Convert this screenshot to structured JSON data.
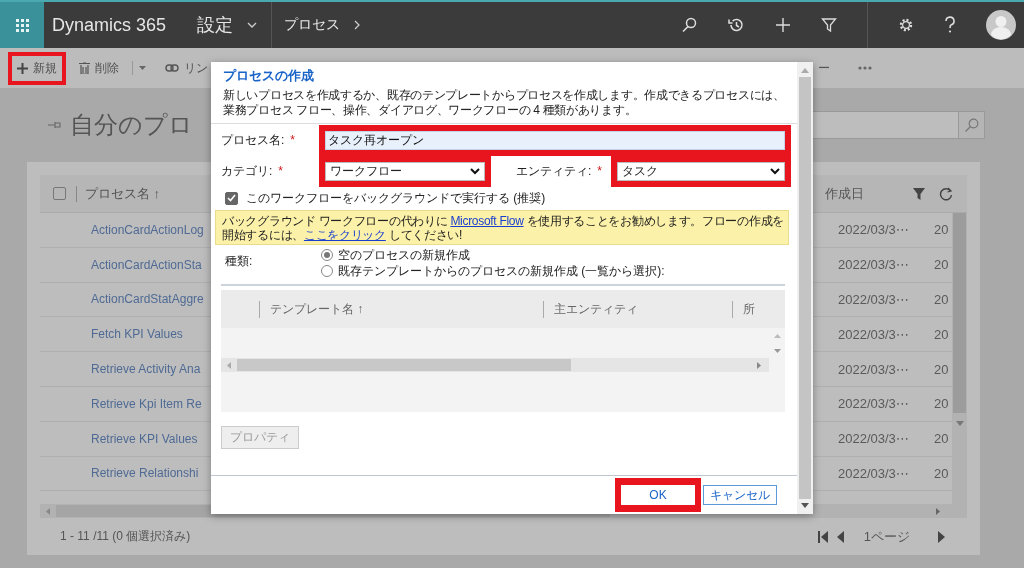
{
  "top_bar": {
    "app_title": "Dynamics 365",
    "area": "設定",
    "breadcrumb": "プロセス"
  },
  "command_bar": [
    {
      "kind": "new",
      "label": "新規",
      "highlighted": true
    },
    {
      "kind": "delete",
      "label": "削除",
      "highlighted": false
    },
    {
      "kind": "link",
      "label": "リン",
      "highlighted": false
    }
  ],
  "command_bar_right": {
    "label": "ー"
  },
  "page_title": "自分のプロ",
  "grid": {
    "select_all_checked": false,
    "columns": [
      {
        "label": "プロセス名 ↑"
      },
      {
        "label": "作成日"
      }
    ],
    "rows": [
      {
        "name": "ActionCardActionLog",
        "created": "2022/03/3⋯",
        "column_3": "20"
      },
      {
        "name": "ActionCardActionSta",
        "created": "2022/03/3⋯",
        "column_3": "20"
      },
      {
        "name": "ActionCardStatAggre",
        "created": "2022/03/3⋯",
        "column_3": "20"
      },
      {
        "name": "Fetch KPI Values",
        "created": "2022/03/3⋯",
        "column_3": "20"
      },
      {
        "name": "Retrieve Activity Ana",
        "created": "2022/03/3⋯",
        "column_3": "20"
      },
      {
        "name": "Retrieve Kpi Item Re",
        "created": "2022/03/3⋯",
        "column_3": "20"
      },
      {
        "name": "Retrieve KPI Values",
        "created": "2022/03/3⋯",
        "column_3": "20"
      },
      {
        "name": "Retrieve Relationshi",
        "created": "2022/03/3⋯",
        "column_3": "20"
      }
    ],
    "footer": "1 - 11 /11 (0 個選択済み)",
    "page": "1ページ"
  },
  "dialog": {
    "title": "プロセスの作成",
    "description": "新しいプロセスを作成するか、既存のテンプレートからプロセスを作成します。作成できるプロセスには、業務プロセス フロー、操作、ダイアログ、ワークフローの 4 種類があります。",
    "process_name": {
      "label": "プロセス名:",
      "required_mark": "*",
      "value": "タスク再オープン",
      "highlighted": true
    },
    "category": {
      "label": "カテゴリ:",
      "required_mark": "*",
      "value": "ワークフロー",
      "highlighted": true
    },
    "entity": {
      "label": "エンティティ:",
      "required_mark": "*",
      "value": "タスク",
      "highlighted": true
    },
    "background": {
      "label": "このワークフローをバックグラウンドで実行する (推奨)",
      "checked": true
    },
    "notice": [
      {
        "kind": "text",
        "text": "バックグラウンド ワークフローの代わりに "
      },
      {
        "kind": "link",
        "text": "Microsoft Flow"
      },
      {
        "kind": "text",
        "text": " を使用することをお勧めします。フローの作成を開始するには、"
      },
      {
        "kind": "link",
        "text": "ここをクリック"
      },
      {
        "kind": "text",
        "text": " してください!"
      }
    ],
    "type": {
      "label": "種類:",
      "options": [
        {
          "label": "空のプロセスの新規作成",
          "selected": true
        },
        {
          "label": "既存テンプレートからのプロセスの新規作成 (一覧から選択):",
          "selected": false
        }
      ]
    },
    "template_grid": {
      "columns": [
        "テンプレート名 ↑",
        "主エンティティ",
        "所"
      ]
    },
    "properties_button": {
      "label": "プロパティ",
      "disabled": true
    },
    "buttons": [
      {
        "label": "OK",
        "highlighted": true
      },
      {
        "label": "キャンセル",
        "highlighted": false
      }
    ]
  }
}
